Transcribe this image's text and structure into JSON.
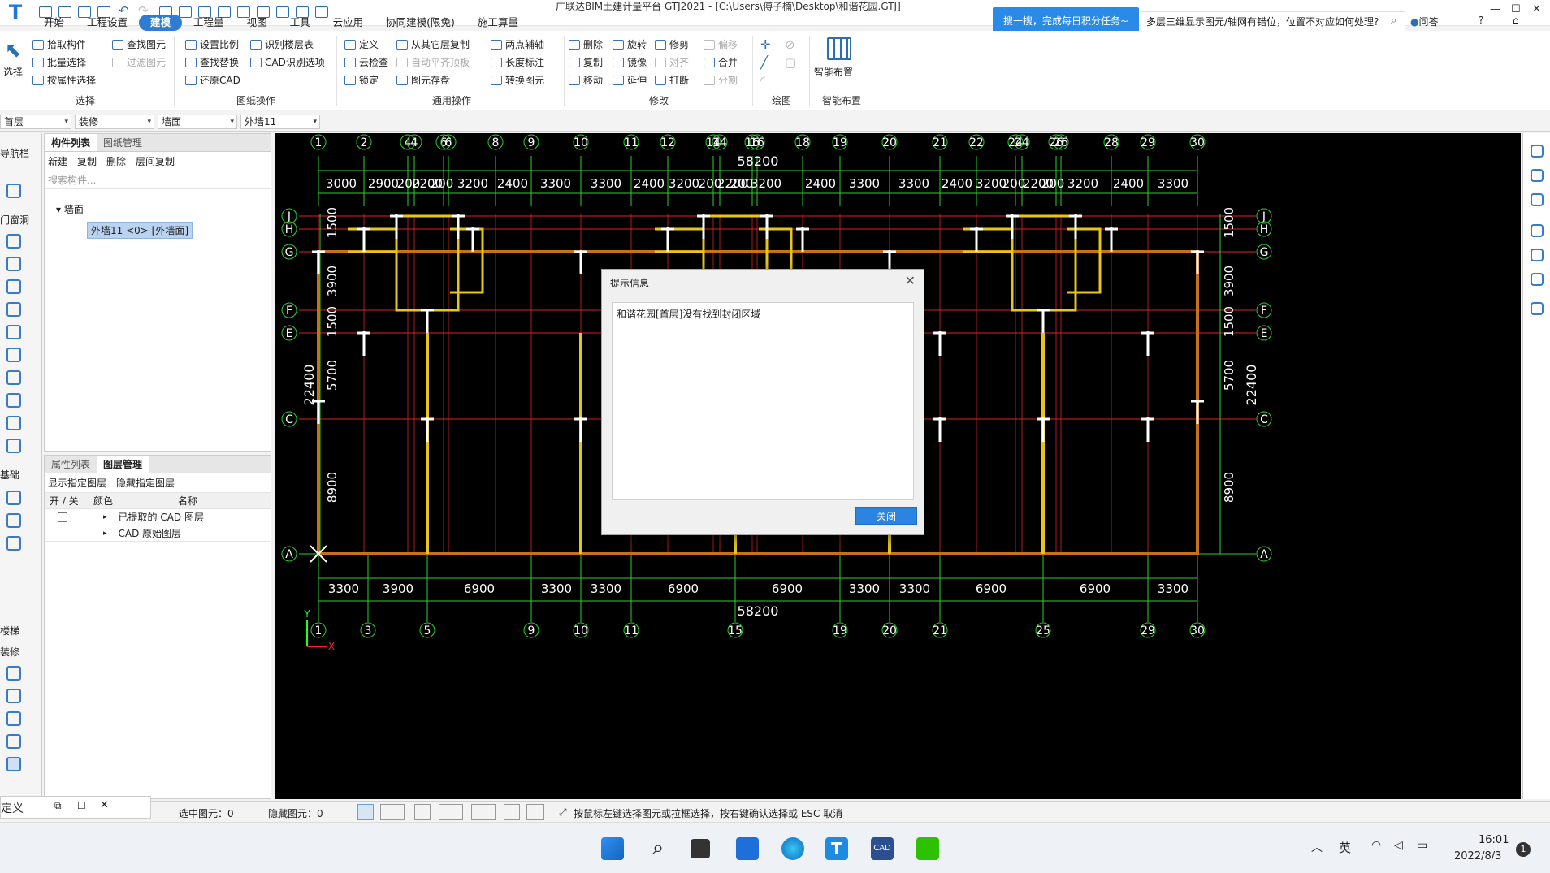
{
  "app": {
    "title": "广联达BIM土建计量平台 GTJ2021 - [C:\\Users\\傅子楠\\Desktop\\和谐花园.GTJ]",
    "logo": "T"
  },
  "ribbon_tabs": [
    "开始",
    "工程设置",
    "建模",
    "工程量",
    "视图",
    "工具",
    "云应用",
    "协同建模(限免)",
    "施工算量"
  ],
  "promo": "搜一搜，完成每日积分任务~",
  "search": {
    "value": "多层三维显示图元/轴网有错位，位置不对应如何处理?"
  },
  "help_link": "问答",
  "window_controls": [
    "?",
    "⌂",
    "—",
    "☐",
    "✕"
  ],
  "ribbon": {
    "select": {
      "big": "选择",
      "b1": "拾取构件",
      "b2": "批量选择",
      "b3": "按属性选择",
      "b4": "查找图元",
      "b5": "过滤图元",
      "label": "选择"
    },
    "drawing": {
      "b1": "设置比例",
      "b2": "查找替换",
      "b3": "还原CAD",
      "b4": "识别楼层表",
      "b5": "CAD识别选项",
      "label": "图纸操作"
    },
    "common": {
      "b1": "定义",
      "b2": "云检查",
      "b3": "锁定",
      "b4": "从其它层复制",
      "b5": "自动平齐顶板",
      "b6": "图元存盘",
      "b7": "两点辅轴",
      "b8": "长度标注",
      "b9": "转换图元",
      "label": "通用操作"
    },
    "modify": {
      "b1": "删除",
      "b2": "复制",
      "b3": "移动",
      "b4": "旋转",
      "b5": "镜像",
      "b6": "延伸",
      "b7": "修剪",
      "b8": "对齐",
      "b9": "打断",
      "b10": "偏移",
      "b11": "合并",
      "b12": "分割",
      "label": "修改"
    },
    "draw": {
      "label": "绘图"
    },
    "smart": {
      "big": "智能布置",
      "label": "智能布置"
    }
  },
  "combos": [
    "首层",
    "装修",
    "墙面",
    "外墙11"
  ],
  "leftnav": {
    "title": "导航栏",
    "items": [
      "门窗洞",
      "基础",
      "楼梯",
      "装修"
    ]
  },
  "component_panel": {
    "tabs": [
      "构件列表",
      "图纸管理"
    ],
    "tools": [
      "新建",
      "复制",
      "删除",
      "层间复制"
    ],
    "search_placeholder": "搜索构件...",
    "tree_root": "墙面",
    "tree_item": "外墙11 <0> [外墙面]"
  },
  "layer_panel": {
    "tabs": [
      "属性列表",
      "图层管理"
    ],
    "tools": [
      "显示指定图层",
      "隐藏指定图层"
    ],
    "headers": [
      "开 / 关",
      "颜色",
      "名称"
    ],
    "rows": [
      "已提取的 CAD 图层",
      "CAD 原始图层"
    ]
  },
  "cad": {
    "top_axes": [
      "1",
      "2",
      "4",
      "4",
      "6",
      "6",
      "8",
      "9",
      "10",
      "11",
      "12",
      "14",
      "14",
      "16",
      "16",
      "18",
      "19",
      "20",
      "21",
      "22",
      "24",
      "24",
      "26",
      "26",
      "28",
      "29",
      "30"
    ],
    "top_total": "58200",
    "top_dims": [
      "3000",
      "2900",
      "200",
      "2200",
      "200",
      "3200",
      "2400",
      "3300",
      "3300",
      "2400",
      "3200",
      "200",
      "2200",
      "200",
      "3200",
      "2400",
      "3300",
      "3300",
      "2400",
      "3200",
      "200",
      "2200",
      "200",
      "3200",
      "2400",
      "3300"
    ],
    "bottom_axes": [
      "1",
      "3",
      "5",
      "9",
      "10",
      "11",
      "15",
      "19",
      "20",
      "21",
      "25",
      "29",
      "30"
    ],
    "bottom_dims": [
      "3300",
      "3900",
      "6900",
      "3300",
      "3300",
      "6900",
      "6900",
      "3300",
      "3300",
      "6900",
      "6900",
      "3300"
    ],
    "bottom_total": "58200",
    "left_axes": [
      "J",
      "H",
      "G",
      "F",
      "E",
      "C",
      "A"
    ],
    "left_dims": [
      "1500",
      "3900",
      "1500",
      "5700",
      "8900"
    ],
    "left_total": "22400",
    "right_dims": [
      "1500",
      "3900",
      "1500",
      "5700",
      "8900"
    ],
    "right_total": "22400",
    "axis_x_label": "X",
    "axis_y_label": "Y"
  },
  "dialog": {
    "title": "提示信息",
    "message": "和谐花园[首层]没有找到封闭区域",
    "button": "关闭"
  },
  "status": {
    "left": "定义",
    "selected": "选中图元：0",
    "hidden": "隐藏图元：0",
    "hint": "按鼠标左键选择图元或拉框选择，按右键确认选择或 ESC 取消"
  },
  "taskbar": {
    "ime": "英",
    "time": "16:01",
    "date": "2022/8/3",
    "badge": "1"
  }
}
